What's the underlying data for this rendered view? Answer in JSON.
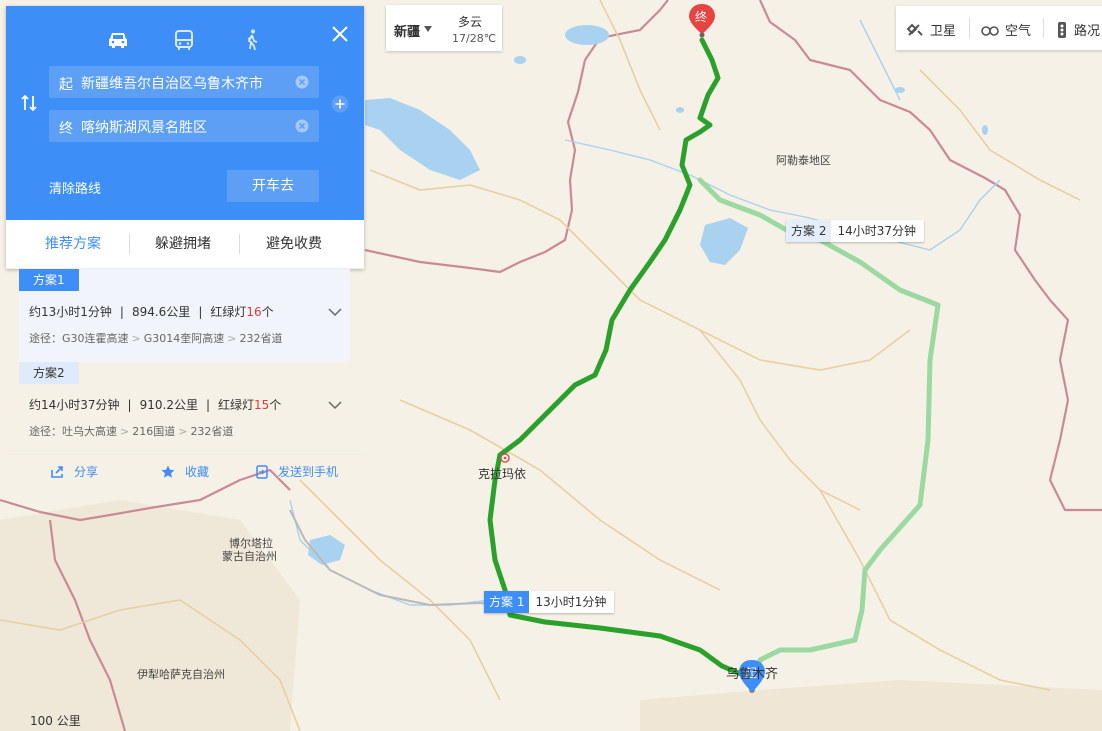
{
  "panel": {
    "start_prefix": "起",
    "start_value": "新疆维吾尔自治区乌鲁木齐市",
    "end_prefix": "终",
    "end_value": "喀纳斯湖风景名胜区",
    "clear_route": "清除路线",
    "drive_button": "开车去",
    "tabs": [
      "推荐方案",
      "躲避拥堵",
      "避免收费"
    ],
    "plans": [
      {
        "tag": "方案1",
        "time": "约13小时1分钟",
        "distance": "894.6公里",
        "lights_label": "红绿灯",
        "lights_count": "16",
        "lights_unit": "个",
        "route_prefix": "途径：",
        "roads": [
          "G30连霍高速",
          "G3014奎阿高速",
          "232省道"
        ]
      },
      {
        "tag": "方案2",
        "time": "约14小时37分钟",
        "distance": "910.2公里",
        "lights_label": "红绿灯",
        "lights_count": "15",
        "lights_unit": "个",
        "route_prefix": "途径：",
        "roads": [
          "吐乌大高速",
          "216国道",
          "232省道"
        ]
      }
    ],
    "actions": {
      "share": "分享",
      "favorite": "收藏",
      "send_phone": "发送到手机"
    }
  },
  "weather": {
    "region": "新疆",
    "condition": "多云",
    "temperature": "17/28℃"
  },
  "toolbar": {
    "satellite": "卫星",
    "air": "空气",
    "traffic": "路况"
  },
  "map": {
    "places": {
      "altay": "阿勒泰地区",
      "karamay": "克拉玛依",
      "bortala_1": "博尔塔拉",
      "bortala_2": "蒙古自治州",
      "ili": "伊犁哈萨克自治州",
      "urumqi": "乌鲁木齐"
    },
    "markers": {
      "start": "起",
      "end": "终"
    },
    "route_labels": [
      {
        "tag": "方案 1",
        "time": "13小时1分钟"
      },
      {
        "tag": "方案 2",
        "time": "14小时37分钟"
      }
    ],
    "scale": "100 公里"
  },
  "colors": {
    "accent": "#3e8ef7",
    "route1": "#2aa12a",
    "route2": "#9bd9a0",
    "border": "#c98a98",
    "water": "#a9d1f0"
  }
}
